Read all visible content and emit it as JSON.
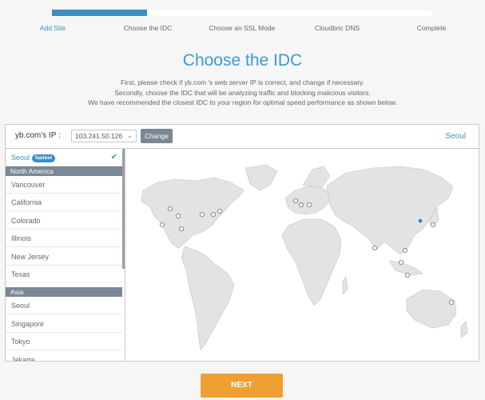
{
  "progress": {
    "fraction": 0.25
  },
  "steps": [
    {
      "label": "Add Site"
    },
    {
      "label": "Choose the IDC"
    },
    {
      "label": "Choose an SSL Mode"
    },
    {
      "label": "Cloudbric DNS"
    },
    {
      "label": "Complete"
    }
  ],
  "page": {
    "title": "Choose the IDC",
    "desc": [
      "First, please check if yb.com 's web server IP is correct, and change if necessary.",
      "Secondly, choose the IDC that will be analyzing traffic and blocking malicious visitors.",
      "We have recommended the closest IDC to your region for optimal speed performance as shown below."
    ]
  },
  "header": {
    "ip_label": "yb.com's IP   :",
    "ip_value": "103.241.50.126",
    "change_label": "Change",
    "selected_region": "Seoul"
  },
  "list": {
    "selected": {
      "label": "Seoul",
      "badge": "fastest"
    },
    "groups": [
      {
        "name": "North America",
        "items": [
          "Vancouver",
          "California",
          "Colorado",
          "Illinois",
          "New Jersey",
          "Texas"
        ]
      },
      {
        "name": "Asia",
        "items": [
          "Seoul",
          "Singapore",
          "Tokyo",
          "Jakarta"
        ]
      }
    ]
  },
  "map": {
    "land_color": "#e3e3e3",
    "marker_color": "#ffffff",
    "active_marker_color": "#3a8fc4"
  },
  "next_label": "NEXT",
  "colors": {
    "accent": "#3a8fc4",
    "next": "#f0a032"
  }
}
